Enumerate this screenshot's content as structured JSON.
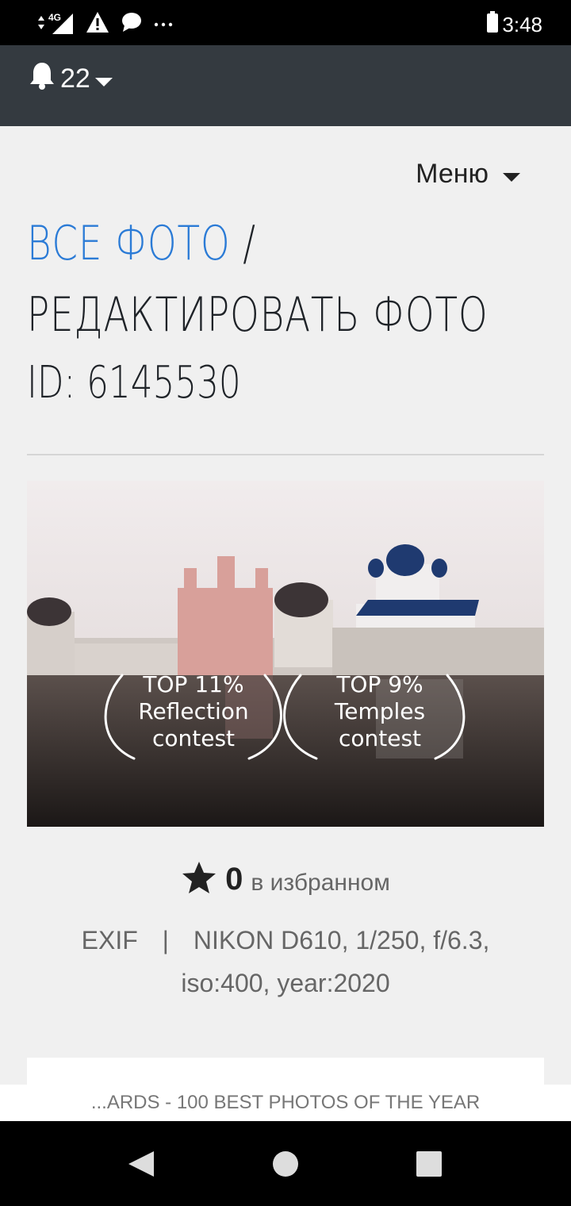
{
  "status_bar": {
    "network": "4G",
    "time": "3:48"
  },
  "app_bar": {
    "notification_count": "22"
  },
  "menu": {
    "label": "Меню"
  },
  "title": {
    "link_text": "ВСЕ ФОТО",
    "separator": "/",
    "current": "РЕДАКТИРОВАТЬ ФОТО",
    "id_line": "ID: 6145530"
  },
  "photo": {
    "awards": [
      {
        "line1": "TOP 11%",
        "line2": "Reflection",
        "line3": "contest"
      },
      {
        "line1": "TOP 9%",
        "line2": "Temples",
        "line3": "contest"
      }
    ]
  },
  "favorites": {
    "count": "0",
    "label": "в избранном"
  },
  "exif": {
    "label": "EXIF",
    "separator": "|",
    "value": "NIKON D610, 1/250, f/6.3, iso:400, year:2020"
  },
  "banner": {
    "text": "...ARDS - 100 BEST PHOTOS OF THE YEAR"
  },
  "colors": {
    "link": "#2b7bd6",
    "app_bar": "#343a40",
    "background": "#f0f0f0"
  },
  "icons": [
    "signal-icon",
    "warning-icon",
    "chat-icon",
    "more-icon",
    "battery-icon",
    "bell-icon",
    "caret-down-icon",
    "star-icon",
    "back-icon",
    "home-icon",
    "recents-icon"
  ]
}
